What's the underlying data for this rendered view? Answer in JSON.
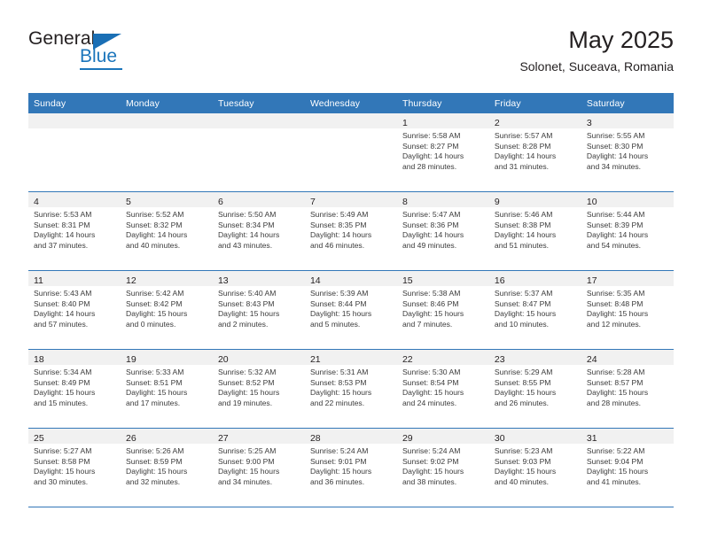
{
  "brand": {
    "name_part1": "General",
    "name_part2": "Blue",
    "triangle_color": "#1a6fb5",
    "blue_color": "#1b75bb"
  },
  "header": {
    "title": "May 2025",
    "subtitle": "Solonet, Suceava, Romania"
  },
  "theme": {
    "header_blue": "#3277b8",
    "band_gray": "#f1f1f1",
    "text": "#231f20"
  },
  "weekdays": [
    "Sunday",
    "Monday",
    "Tuesday",
    "Wednesday",
    "Thursday",
    "Friday",
    "Saturday"
  ],
  "labels": {
    "sunrise": "Sunrise:",
    "sunset": "Sunset:",
    "daylight": "Daylight:"
  },
  "weeks": [
    [
      {
        "day": "",
        "lines": []
      },
      {
        "day": "",
        "lines": []
      },
      {
        "day": "",
        "lines": []
      },
      {
        "day": "",
        "lines": []
      },
      {
        "day": "1",
        "lines": [
          "Sunrise: 5:58 AM",
          "Sunset: 8:27 PM",
          "Daylight: 14 hours",
          "and 28 minutes."
        ]
      },
      {
        "day": "2",
        "lines": [
          "Sunrise: 5:57 AM",
          "Sunset: 8:28 PM",
          "Daylight: 14 hours",
          "and 31 minutes."
        ]
      },
      {
        "day": "3",
        "lines": [
          "Sunrise: 5:55 AM",
          "Sunset: 8:30 PM",
          "Daylight: 14 hours",
          "and 34 minutes."
        ]
      }
    ],
    [
      {
        "day": "4",
        "lines": [
          "Sunrise: 5:53 AM",
          "Sunset: 8:31 PM",
          "Daylight: 14 hours",
          "and 37 minutes."
        ]
      },
      {
        "day": "5",
        "lines": [
          "Sunrise: 5:52 AM",
          "Sunset: 8:32 PM",
          "Daylight: 14 hours",
          "and 40 minutes."
        ]
      },
      {
        "day": "6",
        "lines": [
          "Sunrise: 5:50 AM",
          "Sunset: 8:34 PM",
          "Daylight: 14 hours",
          "and 43 minutes."
        ]
      },
      {
        "day": "7",
        "lines": [
          "Sunrise: 5:49 AM",
          "Sunset: 8:35 PM",
          "Daylight: 14 hours",
          "and 46 minutes."
        ]
      },
      {
        "day": "8",
        "lines": [
          "Sunrise: 5:47 AM",
          "Sunset: 8:36 PM",
          "Daylight: 14 hours",
          "and 49 minutes."
        ]
      },
      {
        "day": "9",
        "lines": [
          "Sunrise: 5:46 AM",
          "Sunset: 8:38 PM",
          "Daylight: 14 hours",
          "and 51 minutes."
        ]
      },
      {
        "day": "10",
        "lines": [
          "Sunrise: 5:44 AM",
          "Sunset: 8:39 PM",
          "Daylight: 14 hours",
          "and 54 minutes."
        ]
      }
    ],
    [
      {
        "day": "11",
        "lines": [
          "Sunrise: 5:43 AM",
          "Sunset: 8:40 PM",
          "Daylight: 14 hours",
          "and 57 minutes."
        ]
      },
      {
        "day": "12",
        "lines": [
          "Sunrise: 5:42 AM",
          "Sunset: 8:42 PM",
          "Daylight: 15 hours",
          "and 0 minutes."
        ]
      },
      {
        "day": "13",
        "lines": [
          "Sunrise: 5:40 AM",
          "Sunset: 8:43 PM",
          "Daylight: 15 hours",
          "and 2 minutes."
        ]
      },
      {
        "day": "14",
        "lines": [
          "Sunrise: 5:39 AM",
          "Sunset: 8:44 PM",
          "Daylight: 15 hours",
          "and 5 minutes."
        ]
      },
      {
        "day": "15",
        "lines": [
          "Sunrise: 5:38 AM",
          "Sunset: 8:46 PM",
          "Daylight: 15 hours",
          "and 7 minutes."
        ]
      },
      {
        "day": "16",
        "lines": [
          "Sunrise: 5:37 AM",
          "Sunset: 8:47 PM",
          "Daylight: 15 hours",
          "and 10 minutes."
        ]
      },
      {
        "day": "17",
        "lines": [
          "Sunrise: 5:35 AM",
          "Sunset: 8:48 PM",
          "Daylight: 15 hours",
          "and 12 minutes."
        ]
      }
    ],
    [
      {
        "day": "18",
        "lines": [
          "Sunrise: 5:34 AM",
          "Sunset: 8:49 PM",
          "Daylight: 15 hours",
          "and 15 minutes."
        ]
      },
      {
        "day": "19",
        "lines": [
          "Sunrise: 5:33 AM",
          "Sunset: 8:51 PM",
          "Daylight: 15 hours",
          "and 17 minutes."
        ]
      },
      {
        "day": "20",
        "lines": [
          "Sunrise: 5:32 AM",
          "Sunset: 8:52 PM",
          "Daylight: 15 hours",
          "and 19 minutes."
        ]
      },
      {
        "day": "21",
        "lines": [
          "Sunrise: 5:31 AM",
          "Sunset: 8:53 PM",
          "Daylight: 15 hours",
          "and 22 minutes."
        ]
      },
      {
        "day": "22",
        "lines": [
          "Sunrise: 5:30 AM",
          "Sunset: 8:54 PM",
          "Daylight: 15 hours",
          "and 24 minutes."
        ]
      },
      {
        "day": "23",
        "lines": [
          "Sunrise: 5:29 AM",
          "Sunset: 8:55 PM",
          "Daylight: 15 hours",
          "and 26 minutes."
        ]
      },
      {
        "day": "24",
        "lines": [
          "Sunrise: 5:28 AM",
          "Sunset: 8:57 PM",
          "Daylight: 15 hours",
          "and 28 minutes."
        ]
      }
    ],
    [
      {
        "day": "25",
        "lines": [
          "Sunrise: 5:27 AM",
          "Sunset: 8:58 PM",
          "Daylight: 15 hours",
          "and 30 minutes."
        ]
      },
      {
        "day": "26",
        "lines": [
          "Sunrise: 5:26 AM",
          "Sunset: 8:59 PM",
          "Daylight: 15 hours",
          "and 32 minutes."
        ]
      },
      {
        "day": "27",
        "lines": [
          "Sunrise: 5:25 AM",
          "Sunset: 9:00 PM",
          "Daylight: 15 hours",
          "and 34 minutes."
        ]
      },
      {
        "day": "28",
        "lines": [
          "Sunrise: 5:24 AM",
          "Sunset: 9:01 PM",
          "Daylight: 15 hours",
          "and 36 minutes."
        ]
      },
      {
        "day": "29",
        "lines": [
          "Sunrise: 5:24 AM",
          "Sunset: 9:02 PM",
          "Daylight: 15 hours",
          "and 38 minutes."
        ]
      },
      {
        "day": "30",
        "lines": [
          "Sunrise: 5:23 AM",
          "Sunset: 9:03 PM",
          "Daylight: 15 hours",
          "and 40 minutes."
        ]
      },
      {
        "day": "31",
        "lines": [
          "Sunrise: 5:22 AM",
          "Sunset: 9:04 PM",
          "Daylight: 15 hours",
          "and 41 minutes."
        ]
      }
    ]
  ]
}
